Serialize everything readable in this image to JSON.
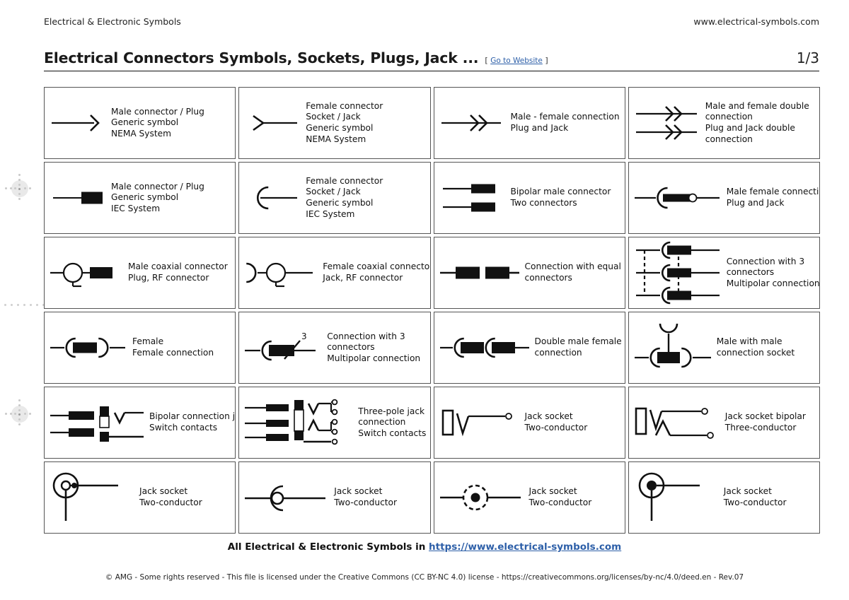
{
  "header": {
    "breadcrumb": "Electrical & Electronic Symbols",
    "site": "www.electrical-symbols.com",
    "title": "Electrical Connectors Symbols, Sockets, Plugs, Jack ...",
    "link_bracket_open": "[",
    "link_label": "Go to Website",
    "link_bracket_close": "]",
    "page": "1/3"
  },
  "footer": {
    "main_prefix": "All Electrical & Electronic Symbols in ",
    "main_link": "https://www.electrical-symbols.com",
    "legal": "© AMG - Some rights reserved - This file is licensed under the Creative Commons (CC BY-NC 4.0) license - https://creativecommons.org/licenses/by-nc/4.0/deed.en - Rev.07"
  },
  "colors": {
    "ink": "#111111",
    "border": "#555555",
    "link": "#2d5fa8",
    "page_bg": "#ffffff"
  },
  "symbols": [
    {
      "id": "male-connector-plug-nema",
      "icon": "arrow-right",
      "lines": [
        "Male connector / Plug",
        "Generic symbol",
        "NEMA System"
      ]
    },
    {
      "id": "female-connector-socket-nema",
      "icon": "chevron-open-left",
      "lines": [
        "Female connector",
        "Socket / Jack",
        "Generic symbol",
        "NEMA System"
      ]
    },
    {
      "id": "male-female-connection",
      "icon": "double-chevron-line",
      "lines": [
        "Male - female connection",
        "Plug and Jack"
      ]
    },
    {
      "id": "male-female-double-connection",
      "icon": "double-chevron-two-lines",
      "lines": [
        "Male and female double",
        "connection",
        "Plug and Jack double",
        "connection"
      ]
    },
    {
      "id": "male-connector-plug-iec",
      "icon": "line-bar",
      "lines": [
        "Male connector / Plug",
        "Generic symbol",
        "IEC System"
      ]
    },
    {
      "id": "female-connector-socket-iec",
      "icon": "arc-open-right",
      "lines": [
        "Female connector",
        "Socket / Jack",
        "Generic symbol",
        "IEC System"
      ]
    },
    {
      "id": "bipolar-male-connector",
      "icon": "two-line-bars",
      "lines": [
        "Bipolar male connector",
        "Two connectors"
      ]
    },
    {
      "id": "male-female-connection-iec",
      "icon": "arc-bar-circle",
      "lines": [
        "Male female connection",
        "Plug and Jack"
      ]
    },
    {
      "id": "male-coaxial-connector",
      "icon": "coax-male",
      "lines": [
        "Male coaxial connector",
        "Plug, RF connector"
      ]
    },
    {
      "id": "female-coaxial-connector",
      "icon": "coax-female",
      "lines": [
        "Female coaxial connector",
        "Jack, RF connector"
      ]
    },
    {
      "id": "connection-equal-connectors",
      "icon": "two-bars-inline",
      "lines": [
        "Connection with equal",
        "connectors"
      ]
    },
    {
      "id": "connection-3-connectors-multi",
      "icon": "triple-arc-bar-dashed",
      "lines": [
        "Connection with 3",
        "connectors",
        "Multipolar connection"
      ]
    },
    {
      "id": "female-female-connection",
      "icon": "arc-bar-arc",
      "lines": [
        "Female",
        "Female connection"
      ]
    },
    {
      "id": "connection-3-connectors-slash",
      "icon": "arc-bar-slash-3",
      "lines": [
        "Connection with 3",
        "connectors",
        "Multipolar connection"
      ]
    },
    {
      "id": "double-male-female-connection",
      "icon": "arc-bar-arc-bar",
      "lines": [
        "Double male female",
        "connection"
      ]
    },
    {
      "id": "male-with-male-connection-socket",
      "icon": "arc-bar-arc-antenna",
      "lines": [
        "Male with male",
        "connection socket"
      ]
    },
    {
      "id": "bipolar-connection-jack",
      "icon": "jack-bipolar-switch",
      "lines": [
        "Bipolar connection jack",
        "Switch contacts"
      ]
    },
    {
      "id": "three-pole-jack-connection",
      "icon": "jack-threepole-switch",
      "lines": [
        "Three-pole jack",
        "connection",
        "Switch contacts"
      ]
    },
    {
      "id": "jack-socket-two-conductor-a",
      "icon": "jack-socket-v",
      "lines": [
        "Jack socket",
        "Two-conductor"
      ]
    },
    {
      "id": "jack-socket-bipolar-three",
      "icon": "jack-socket-v-a",
      "lines": [
        "Jack socket bipolar",
        "Three-conductor"
      ]
    },
    {
      "id": "jack-socket-two-conductor-b",
      "icon": "circle-ring-tail",
      "lines": [
        "Jack socket",
        "Two-conductor"
      ]
    },
    {
      "id": "jack-socket-two-conductor-c",
      "icon": "c-arc-ring-line",
      "lines": [
        "Jack socket",
        "Two-conductor"
      ]
    },
    {
      "id": "jack-socket-two-conductor-d",
      "icon": "dashed-circle-dot",
      "lines": [
        "Jack socket",
        "Two-conductor"
      ]
    },
    {
      "id": "jack-socket-two-conductor-e",
      "icon": "circle-dot-tail",
      "lines": [
        "Jack socket",
        "Two-conductor"
      ]
    }
  ]
}
